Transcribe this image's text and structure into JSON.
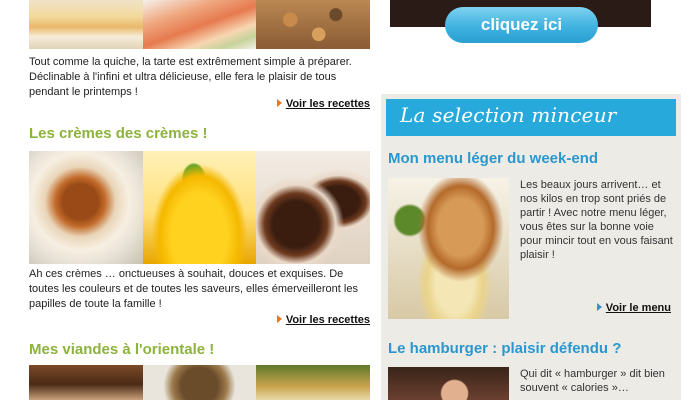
{
  "left": {
    "section1": {
      "description": "Tout comme la quiche, la tarte est extrêmement simple à préparer. Déclinable à l'infini et ultra délicieuse, elle fera le plaisir de tous pendant le printemps !",
      "link": "Voir les recettes"
    },
    "section2": {
      "title": "Les crèmes des crèmes !",
      "description": "Ah ces crèmes … onctueuses à souhait, douces et exquises. De toutes les couleurs et de toutes les saveurs, elles émerveilleront les papilles de toute la famille !",
      "link": "Voir les recettes"
    },
    "section3": {
      "title": "Mes viandes à l'orientale !"
    }
  },
  "banner": {
    "cta_label": "cliquez ici"
  },
  "panel": {
    "heading": "La selection minceur",
    "article1": {
      "title": "Mon menu léger du week-end",
      "text": "Les beaux jours arrivent… et nos kilos en trop sont priés de partir ! Avec notre menu léger, vous êtes sur la bonne voie pour mincir tout en vous faisant plaisir !",
      "link": "Voir le menu"
    },
    "article2": {
      "title": "Le hamburger : plaisir défendu ?",
      "text": "Qui dit « hamburger » dit bien souvent « calories »… CuisineAZ Minceur vous"
    }
  },
  "colors": {
    "section_title_green": "#8cb33c",
    "panel_blue": "#27a9dc",
    "link_arrow_orange": "#e07b1a",
    "panel_bg": "#ecebe6"
  }
}
